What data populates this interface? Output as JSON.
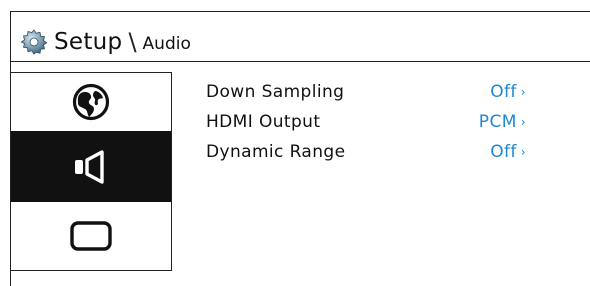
{
  "breadcrumb": {
    "root": "Setup",
    "separator": "\\",
    "current": "Audio",
    "icon": "gear-icon"
  },
  "sidebar": {
    "items": [
      {
        "icon": "globe-icon",
        "selected": false
      },
      {
        "icon": "speaker-icon",
        "selected": true
      },
      {
        "icon": "screen-icon",
        "selected": false
      }
    ]
  },
  "menu": {
    "items": [
      {
        "label": "Down Sampling",
        "value": "Off",
        "chevron": "›"
      },
      {
        "label": "HDMI Output",
        "value": "PCM",
        "chevron": "›"
      },
      {
        "label": "Dynamic Range",
        "value": "Off",
        "chevron": "›"
      }
    ]
  },
  "colors": {
    "value": "#1f87d6",
    "selected_bg": "#111111",
    "text": "#111111"
  }
}
